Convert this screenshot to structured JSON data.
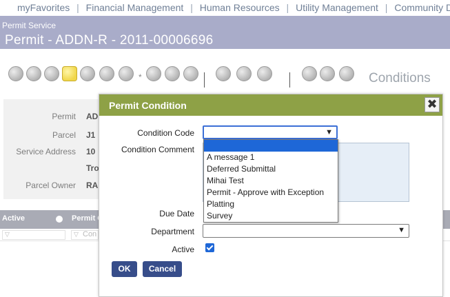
{
  "topnav": {
    "items": [
      "myFavorites",
      "Financial Management",
      "Human Resources",
      "Utility Management",
      "Community Development"
    ],
    "separator": "|"
  },
  "header": {
    "section": "Permit Service",
    "title": "Permit - ADDN-R - 2011-00006696"
  },
  "toolbar": {
    "icons": [
      "info-icon",
      "person-icon",
      "fee-icon",
      "inspection-icon",
      "edit-icon",
      "contact-icon",
      "no-entry-icon",
      "document-icon",
      "search-map-icon",
      "people-icon",
      "report-icon",
      "scope-icon",
      "home-icon",
      "money-person-icon",
      "link-icon",
      "print-icon"
    ],
    "separator_glyph": "*",
    "section_label": "Conditions"
  },
  "details": {
    "rows": [
      {
        "label": "Permit",
        "value": "AD"
      },
      {
        "label": "Parcel",
        "value": "J1"
      },
      {
        "label": "Service Address",
        "value": "10"
      },
      {
        "label": "",
        "value": "Tro"
      },
      {
        "label": "Parcel Owner",
        "value": "RA"
      }
    ]
  },
  "grid": {
    "columns": [
      "Active",
      "Permit C"
    ],
    "filter_placeholder": "Con"
  },
  "modal": {
    "title": "Permit Condition",
    "close_glyph": "✖",
    "fields": {
      "condition_code_label": "Condition Code",
      "condition_code_value": "",
      "condition_comment_label": "Condition Comment",
      "due_date_label": "Due Date",
      "department_label": "Department",
      "department_value": "",
      "active_label": "Active",
      "active_checked": true
    },
    "dropdown_options": [
      "",
      "A message 1",
      "Deferred Submittal",
      "Mihai Test",
      "Permit - Approve with Exception",
      "Platting",
      "Survey"
    ],
    "dropdown_selected_index": 0,
    "buttons": {
      "ok": "OK",
      "cancel": "Cancel"
    }
  },
  "colors": {
    "header_band": "#a9acc9",
    "modal_head": "#8ea146",
    "button": "#374d8a",
    "selection": "#1e67d7"
  }
}
